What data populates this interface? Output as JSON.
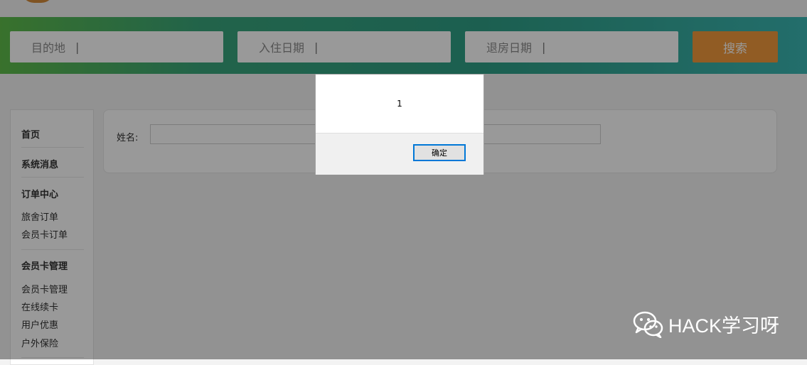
{
  "search": {
    "destination_placeholder": "目的地",
    "checkin_placeholder": "入住日期",
    "checkout_placeholder": "退房日期",
    "caret": "|",
    "search_label": "搜索"
  },
  "sidebar": {
    "items": [
      {
        "label": "首页"
      },
      {
        "label": "系统消息"
      },
      {
        "label": "订单中心"
      },
      {
        "label": "旅舍订单"
      },
      {
        "label": "会员卡订单"
      },
      {
        "label": "会员卡管理"
      },
      {
        "label": "会员卡管理"
      },
      {
        "label": "在线续卡"
      },
      {
        "label": "用户优惠"
      },
      {
        "label": "户外保险"
      }
    ]
  },
  "form": {
    "name_label": "姓名:",
    "name_value": ""
  },
  "dialog": {
    "message": "1",
    "ok_label": "确定"
  },
  "watermark": {
    "text": "HACK学习呀",
    "icon": "wechat-icon"
  },
  "colors": {
    "search_gradient_start": "#5fbd4a",
    "search_gradient_end": "#3bb7b3",
    "search_button": "#f29a3c",
    "dialog_button_border": "#0078d7"
  }
}
